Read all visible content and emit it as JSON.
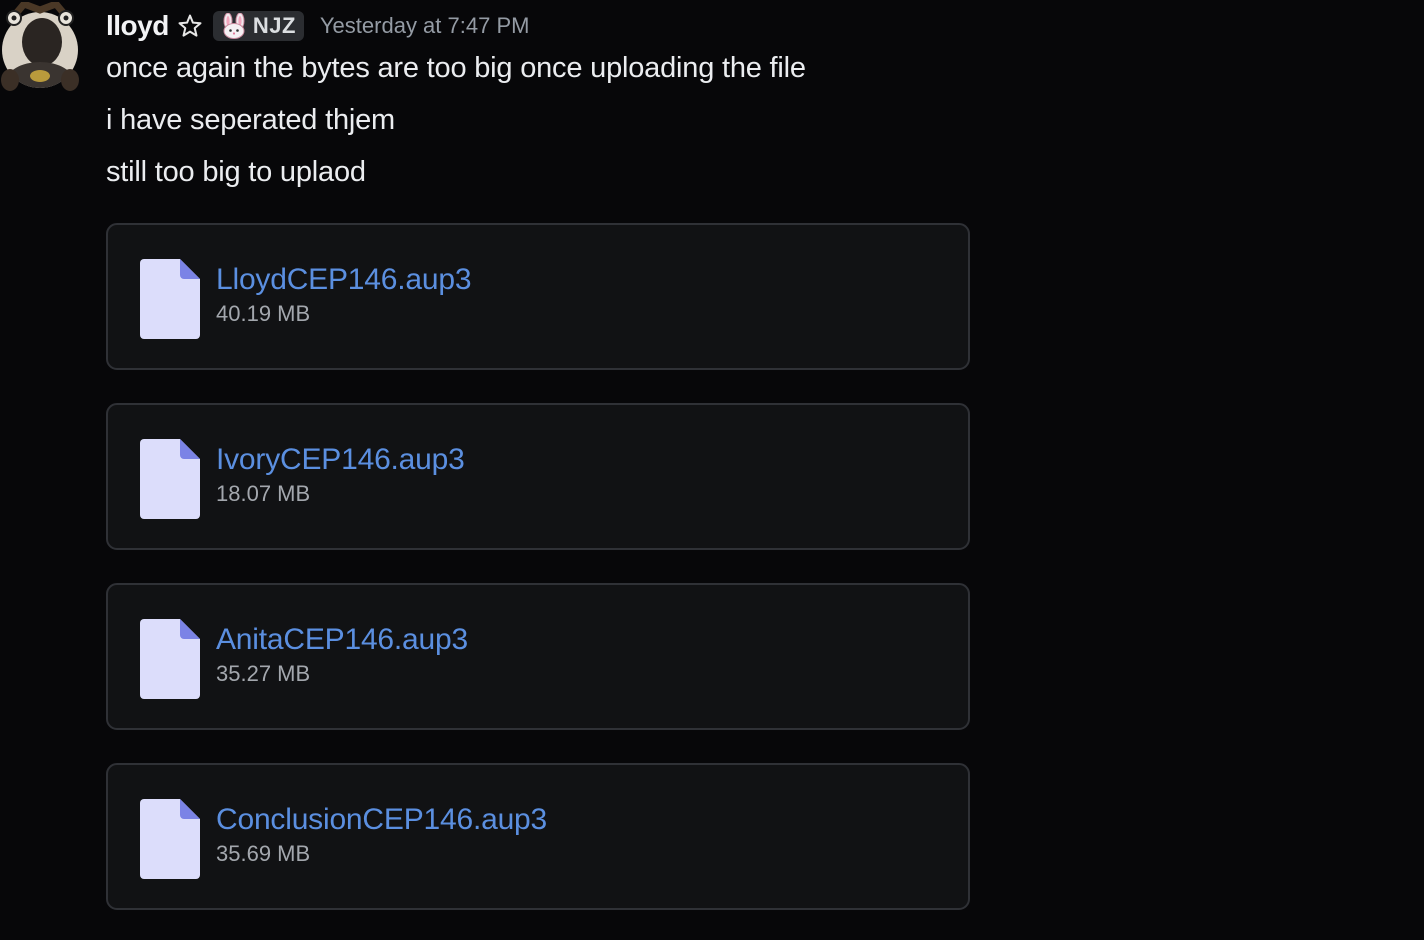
{
  "message": {
    "author": "lloyd",
    "author_icon": "star-outline-icon",
    "tag": {
      "icon": "bunny-icon",
      "label": "NJZ"
    },
    "timestamp": "Yesterday at 7:47 PM",
    "lines": [
      "once again the bytes are too big once uploading the file",
      "i have seperated thjem",
      "still too big to uplaod"
    ],
    "attachments": [
      {
        "name": "LloydCEP146.aup3",
        "size": "40.19 MB"
      },
      {
        "name": "IvoryCEP146.aup3",
        "size": "18.07 MB"
      },
      {
        "name": "AnitaCEP146.aup3",
        "size": "35.27 MB"
      },
      {
        "name": "ConclusionCEP146.aup3",
        "size": "35.69 MB"
      }
    ]
  },
  "colors": {
    "background": "#070709",
    "attachment_bg": "#111214",
    "attachment_border": "#2f3136",
    "link": "#5b8fe0",
    "file_icon": "#dcddfb",
    "file_icon_fold": "#7b83e6"
  }
}
